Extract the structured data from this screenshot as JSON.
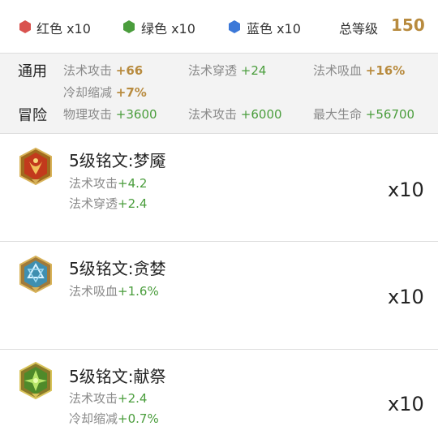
{
  "header": {
    "gems": [
      {
        "label": "红色 x10",
        "icon": "red-hexagon-gem-icon",
        "color": "#d9534f"
      },
      {
        "label": "绿色 x10",
        "icon": "green-hexagon-gem-icon",
        "color": "#4a9d3c"
      },
      {
        "label": "蓝色 x10",
        "icon": "blue-hexagon-gem-icon",
        "color": "#3b78d8"
      }
    ],
    "total_level_label": "总等级",
    "total_level_value": "150"
  },
  "summary": {
    "general_label": "通用",
    "general_stats": [
      {
        "name": "法术攻击",
        "value": "+66"
      },
      {
        "name": "法术穿透",
        "value": "+24"
      },
      {
        "name": "法术吸血",
        "value": "+16%"
      },
      {
        "name": "冷却缩减",
        "value": "+7%"
      }
    ],
    "adventure_label": "冒险",
    "adventure_stats": [
      {
        "name": "物理攻击",
        "value": "+3600"
      },
      {
        "name": "法术攻击",
        "value": "+6000"
      },
      {
        "name": "最大生命",
        "value": "+56700"
      }
    ]
  },
  "runes": [
    {
      "title": "5级铭文:梦魇",
      "icon": "red-rune-icon",
      "stats": [
        {
          "name": "法术攻击",
          "value": "+4.2"
        },
        {
          "name": "法术穿透",
          "value": "+2.4"
        }
      ],
      "count": "x10"
    },
    {
      "title": "5级铭文:贪婪",
      "icon": "blue-rune-icon",
      "stats": [
        {
          "name": "法术吸血",
          "value": "+1.6%"
        }
      ],
      "count": "x10"
    },
    {
      "title": "5级铭文:献祭",
      "icon": "green-rune-icon",
      "stats": [
        {
          "name": "法术攻击",
          "value": "+2.4"
        },
        {
          "name": "冷却缩减",
          "value": "+0.7%"
        }
      ],
      "count": "x10"
    }
  ],
  "colors": {
    "gold_accent": "#b88b3f",
    "green_value": "#4a9d3c",
    "label_gray": "#8a8a8a"
  }
}
